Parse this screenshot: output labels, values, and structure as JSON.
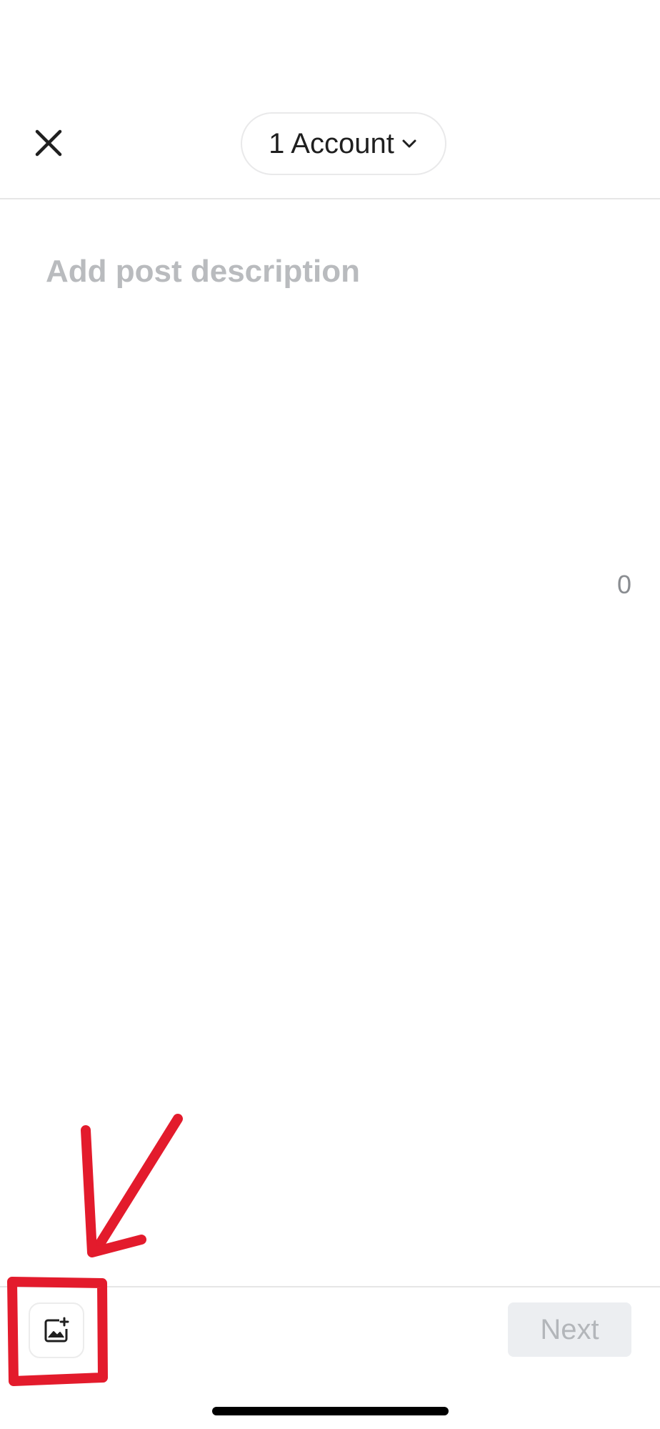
{
  "header": {
    "account_selector_label": "1 Account"
  },
  "composer": {
    "description_placeholder": "Add post description",
    "description_value": "",
    "char_count": "0"
  },
  "footer": {
    "next_label": "Next"
  },
  "icons": {
    "close": "close-icon",
    "chevron": "chevron-down-icon",
    "add_media": "add-image-icon"
  },
  "colors": {
    "annotation_red": "#e31b2c",
    "placeholder_gray": "#b9bbbe",
    "next_disabled_bg": "#eceef1",
    "next_disabled_text": "#b3b6ba"
  }
}
